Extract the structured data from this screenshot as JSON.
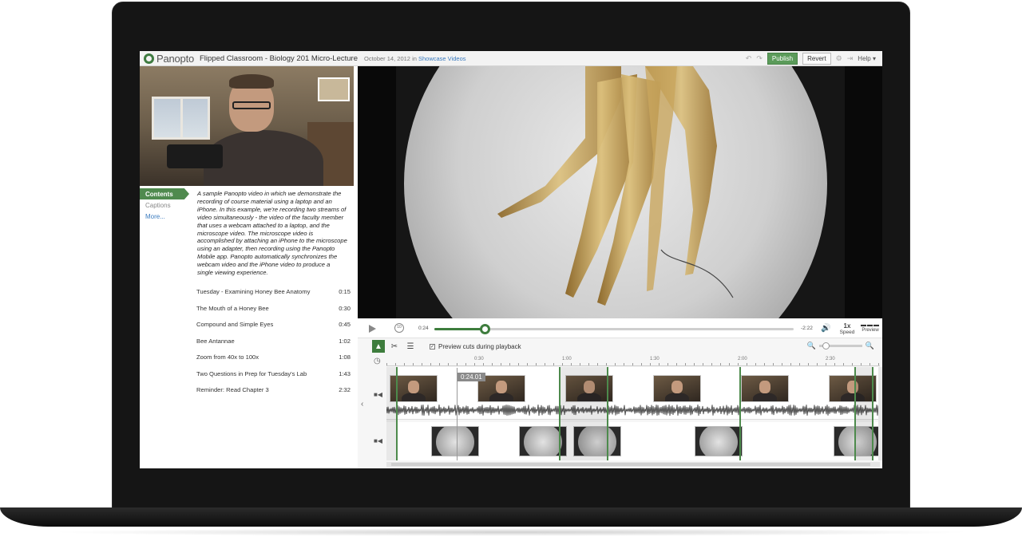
{
  "header": {
    "logo_text": "Panopto",
    "title": "Flipped Classroom - Biology 201 Micro-Lecture",
    "date": "October 14, 2012",
    "in_word": "in",
    "folder": "Showcase Videos",
    "publish_label": "Publish",
    "revert_label": "Revert",
    "help_label": "Help"
  },
  "sidebar": {
    "tabs": [
      {
        "label": "Contents"
      },
      {
        "label": "Captions"
      },
      {
        "label": "More..."
      }
    ],
    "description": "A sample Panopto video in which we demonstrate the recording of course material using a laptop and an iPhone.  In this example, we're recording two streams of video simultaneously - the video of the faculty member that uses a webcam attached to a laptop, and the microscope video.  The microscope video is accomplished by attaching an iPhone to the microscope using an adapter, then recording using the Panopto Mobile app.  Panopto automatically synchronizes the webcam video and the iPhone video to produce a single viewing experience.",
    "contents": [
      {
        "title": "Tuesday - Examining Honey Bee Anatomy",
        "time": "0:15"
      },
      {
        "title": "The Mouth of a Honey Bee",
        "time": "0:30"
      },
      {
        "title": "Compound and Simple Eyes",
        "time": "0:45"
      },
      {
        "title": "Bee Antannae",
        "time": "1:02"
      },
      {
        "title": "Zoom from 40x to 100x",
        "time": "1:08"
      },
      {
        "title": "Two Questions in Prep for Tuesday's Lab",
        "time": "1:43"
      },
      {
        "title": "Reminder: Read Chapter 3",
        "time": "2:32"
      }
    ]
  },
  "player": {
    "current_time": "0:24",
    "remaining_time": "-2:22",
    "progress": 0.14,
    "rewind_label": "10",
    "speed_value": "1x",
    "speed_label": "Speed",
    "preview_label": "Preview"
  },
  "editor": {
    "preview_cuts_label": "Preview cuts during playback",
    "ruler_labels": [
      "0:30",
      "1:00",
      "1:30",
      "2:00",
      "2:30"
    ],
    "playhead_time": "0:24.01"
  },
  "colors": {
    "accent": "#3e7d3d",
    "publish": "#5b9b5a",
    "link": "#3b7bbf"
  },
  "icons": [
    "undo-icon",
    "redo-icon",
    "settings-icon",
    "exit-icon",
    "play-icon",
    "rewind-icon",
    "volume-icon",
    "select-tool-icon",
    "cut-tool-icon",
    "list-icon",
    "clock-icon",
    "camera-icon",
    "zoom-out-icon",
    "zoom-in-icon"
  ]
}
